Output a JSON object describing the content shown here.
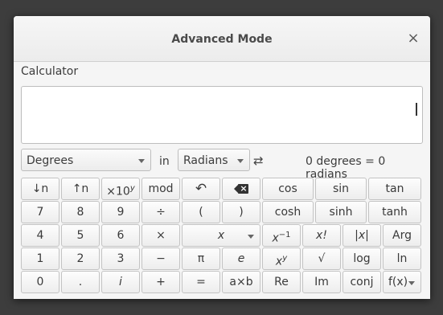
{
  "window": {
    "title": "Advanced Mode",
    "close_glyph": "×"
  },
  "calculator": {
    "label": "Calculator",
    "display_value": ""
  },
  "conversion": {
    "from_unit": "Degrees",
    "in_label": "in",
    "to_unit": "Radians",
    "swap_glyph": "⇄",
    "result": "0 degrees = 0 radians"
  },
  "buttons": {
    "r1": [
      "↓n",
      "↑n",
      "×10",
      "mod",
      "↶",
      "⌫",
      "cos",
      "sin",
      "tan"
    ],
    "x10_sup": "y",
    "r2": [
      "7",
      "8",
      "9",
      "÷",
      "(",
      ")",
      "cosh",
      "sinh",
      "tanh"
    ],
    "r3": [
      "4",
      "5",
      "6",
      "×",
      "x",
      "x",
      "−1",
      "x!",
      "|x|",
      "Arg"
    ],
    "r4": [
      "1",
      "2",
      "3",
      "−",
      "π",
      "e",
      "x",
      "y",
      "√",
      "log",
      "ln"
    ],
    "r5": [
      "0",
      ".",
      "i",
      "+",
      "=",
      "a×b",
      "Re",
      "Im",
      "conj",
      "f(x)"
    ]
  }
}
